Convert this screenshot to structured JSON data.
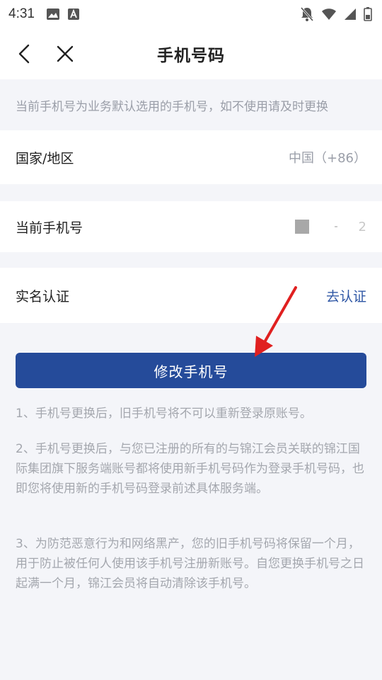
{
  "status_bar": {
    "time": "4:31"
  },
  "nav": {
    "title": "手机号码"
  },
  "notice": "当前手机号为业务默认选用的手机号，如不使用请及时更换",
  "rows": {
    "country": {
      "label": "国家/地区",
      "value": "中国（+86）"
    },
    "phone": {
      "label": "当前手机号",
      "value_tail": "2"
    },
    "realname": {
      "label": "实名认证",
      "link": "去认证"
    }
  },
  "button": {
    "label": "修改手机号"
  },
  "notes": [
    "1、手机号更换后，旧手机号将不可以重新登录原账号。",
    "2、手机号更换后，与您已注册的所有的与锦江会员关联的锦江国际集团旗下服务端账号都将使用新手机号码作为登录手机号码，也即您将使用新的手机号码登录前述具体服务端。",
    "3、为防范恶意行为和网络黑产，您的旧手机号码将保留一个月，用于防止被任何人使用该手机号注册新账号。自您更换手机号之日起满一个月，锦江会员将自动清除该手机号。"
  ],
  "colors": {
    "primary": "#254b9a",
    "link": "#2f57a5",
    "annotation_arrow": "#e02020",
    "background": "#f4f5f9"
  }
}
